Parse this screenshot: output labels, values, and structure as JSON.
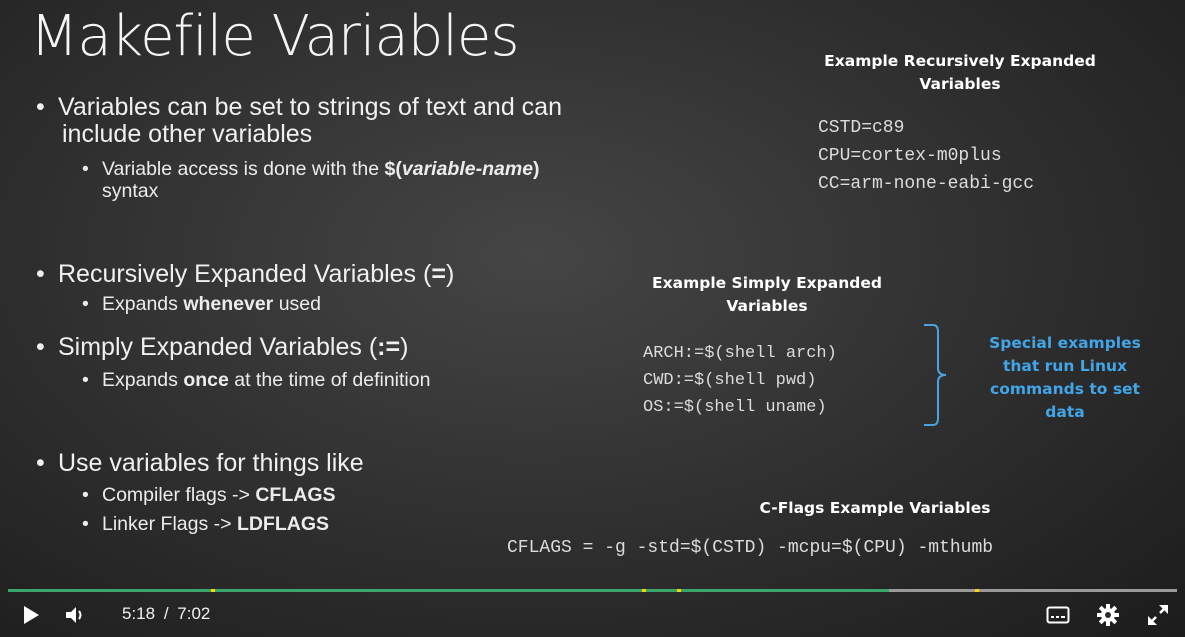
{
  "slide": {
    "title": "Makefile Variables",
    "bullets": {
      "b1_line1": "Variables can be set to strings of text and can",
      "b1_line2": "include other variables",
      "b1_sub_pre": "Variable access is done with the ",
      "b1_sub_bold1": "$(",
      "b1_sub_italic": "variable-name",
      "b1_sub_bold2": ")",
      "b1_sub_line2": "syntax",
      "b2": "Recursively Expanded Variables (",
      "b2_bold": "=",
      "b2_close": ")",
      "b2_sub_pre": "Expands ",
      "b2_sub_bold": "whenever",
      "b2_sub_post": " used",
      "b3": "Simply Expanded Variables (",
      "b3_bold": ":=",
      "b3_close": ")",
      "b3_sub_pre": "Expands ",
      "b3_sub_bold": "once",
      "b3_sub_post": " at the time of definition",
      "b4": "Use variables for things like",
      "b4_sub1_pre": "Compiler flags -> ",
      "b4_sub1_bold": "CFLAGS",
      "b4_sub2_pre": "Linker Flags -> ",
      "b4_sub2_bold": "LDFLAGS"
    },
    "recursive_example": {
      "heading_line1": "Example Recursively Expanded",
      "heading_line2": "Variables",
      "lines": [
        "CSTD=c89",
        "CPU=cortex-m0plus",
        "CC=arm-none-eabi-gcc"
      ]
    },
    "simple_example": {
      "heading_line1": "Example Simply Expanded",
      "heading_line2": "Variables",
      "lines": [
        "ARCH:=$(shell arch)",
        "CWD:=$(shell pwd)",
        "OS:=$(shell uname)"
      ],
      "note": [
        "Special examples",
        "that run Linux",
        "commands to set",
        "data"
      ]
    },
    "cflags_example": {
      "heading": "C-Flags Example Variables",
      "line": "CFLAGS = -g -std=$(CSTD) -mcpu=$(CPU) -mthumb"
    }
  },
  "player": {
    "current_time": "5:18",
    "separator": "/",
    "duration": "7:02",
    "progress_fraction": 0.754,
    "chapter_marker_fractions": [
      0.174,
      0.542,
      0.572,
      0.827
    ],
    "colors": {
      "played": "#3aa76a",
      "unplayed": "#9a9a9a",
      "marker": "#ffd500",
      "note": "#42a5e8"
    },
    "icons": [
      "play-icon",
      "volume-icon",
      "subtitles-icon",
      "settings-gear-icon",
      "fullscreen-icon"
    ]
  }
}
